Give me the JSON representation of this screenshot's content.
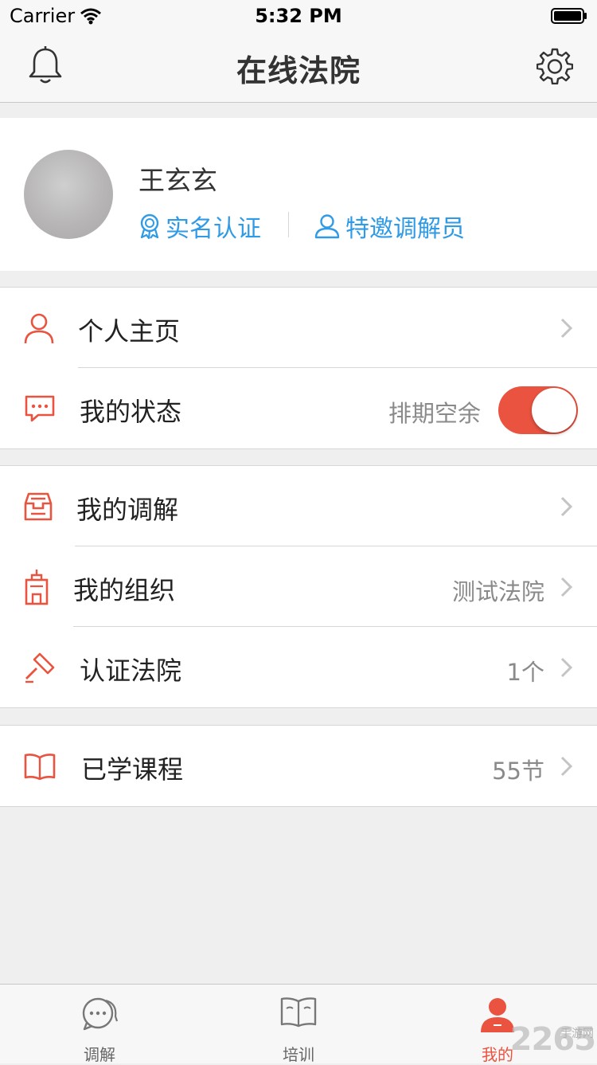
{
  "status_bar": {
    "carrier": "Carrier",
    "time": "5:32 PM"
  },
  "navbar": {
    "title": "在线法院",
    "left_icon": "bell-icon",
    "right_icon": "gear-icon"
  },
  "profile": {
    "name": "王玄玄",
    "badges": [
      {
        "label": "实名认证",
        "icon": "award-icon"
      },
      {
        "label": "特邀调解员",
        "icon": "user-outline-icon"
      }
    ],
    "accent_color": "#2f9ae6"
  },
  "menu": {
    "group1": [
      {
        "label": "个人主页",
        "icon": "person-icon"
      },
      {
        "label": "我的状态",
        "value": "排期空余",
        "icon": "chat-icon",
        "toggle_on": true
      }
    ],
    "group2": [
      {
        "label": "我的调解",
        "icon": "inbox-icon"
      },
      {
        "label": "我的组织",
        "value": "测试法院",
        "icon": "building-icon"
      },
      {
        "label": "认证法院",
        "value": "1个",
        "icon": "gavel-icon"
      }
    ],
    "group3": [
      {
        "label": "已学课程",
        "value": "55节",
        "icon": "book-icon"
      }
    ],
    "icon_color": "#ea533f"
  },
  "tabbar": {
    "tabs": [
      {
        "label": "调解",
        "icon": "chat-bubbles-icon",
        "active": false
      },
      {
        "label": "培训",
        "icon": "open-book-icon",
        "active": false
      },
      {
        "label": "我的",
        "icon": "user-filled-icon",
        "active": true
      }
    ],
    "active_color": "#ea533f"
  },
  "watermark": {
    "main": "2265",
    "sub": "手游网"
  }
}
